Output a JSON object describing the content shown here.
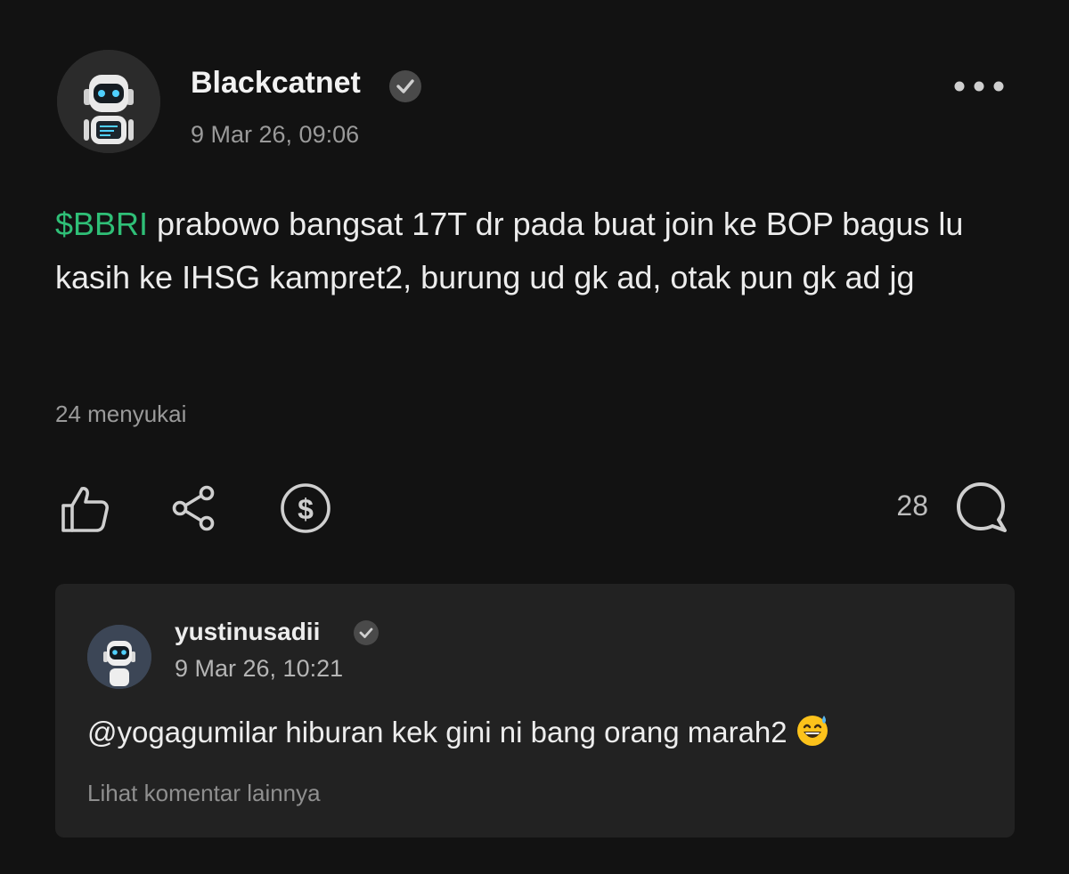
{
  "post": {
    "author": "Blackcatnet",
    "timestamp": "9 Mar 26, 09:06",
    "ticker": "$BBRI",
    "body": " prabowo bangsat 17T dr pada buat join ke BOP bagus lu kasih ke IHSG kampret2, burung ud gk ad, otak pun gk ad jg",
    "likes_text": "24 menyukai",
    "comment_count": "28"
  },
  "comment": {
    "author": "yustinusadii",
    "timestamp": "9 Mar 26, 10:21",
    "text": "@yogagumilar hiburan kek gini ni bang orang marah2",
    "more_label": "Lihat komentar lainnya"
  },
  "icons": {
    "verified": "verified-badge-icon",
    "more": "more-horizontal-icon",
    "like": "thumbs-up-icon",
    "share": "share-icon",
    "tip": "dollar-circle-icon",
    "comment": "comment-bubble-icon",
    "emoji": "grinning-sweat-emoji"
  },
  "colors": {
    "background": "#121212",
    "ticker": "#2fbf77",
    "comment_card": "#222222",
    "muted_text": "#9a9a9a"
  }
}
